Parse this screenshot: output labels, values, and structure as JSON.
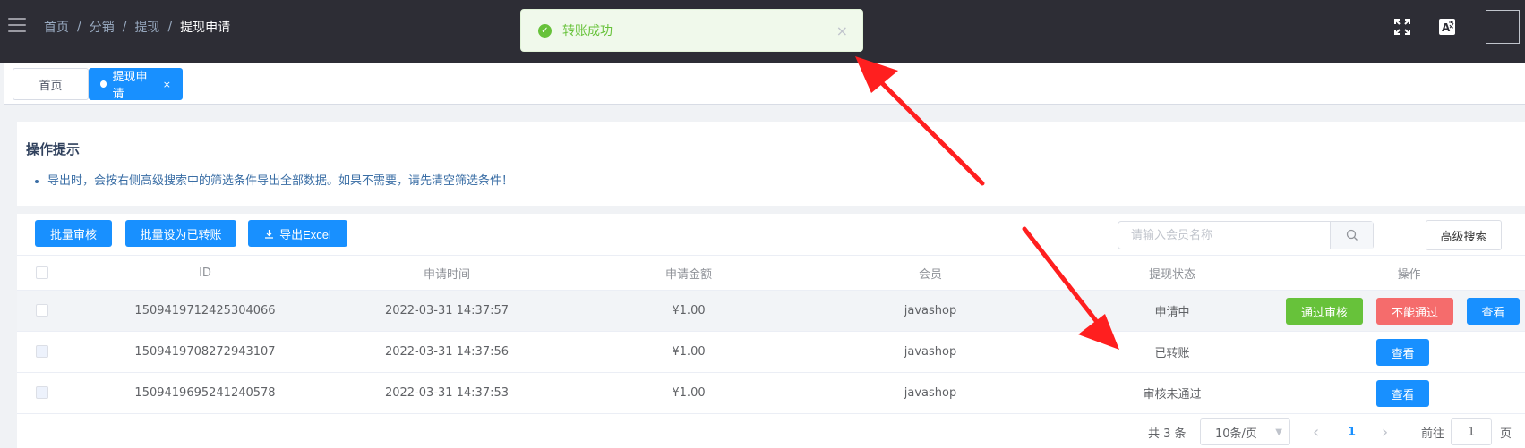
{
  "header": {
    "breadcrumb": [
      "首页",
      "分销",
      "提现",
      "提现申请"
    ],
    "separator": "/"
  },
  "toast": {
    "message": "转账成功",
    "close": "×"
  },
  "tags": [
    {
      "label": "首页"
    },
    {
      "label": "提现申请",
      "close": "×"
    }
  ],
  "tips": {
    "title": "操作提示",
    "items": [
      "导出时，会按右侧高级搜索中的筛选条件导出全部数据。如果不需要，请先清空筛选条件！"
    ]
  },
  "toolbar": {
    "batch_audit": "批量审核",
    "batch_transferred": "批量设为已转账",
    "export_excel": "导出Excel",
    "export_icon": "download-icon"
  },
  "search": {
    "placeholder": "请输入会员名称",
    "advanced": "高级搜索"
  },
  "table": {
    "columns": [
      "ID",
      "申请时间",
      "申请金额",
      "会员",
      "提现状态",
      "操作"
    ],
    "rows": [
      {
        "id": "1509419712425304066",
        "time": "2022-03-31 14:37:57",
        "amount": "¥1.00",
        "member": "javashop",
        "status": "申请中",
        "actions": [
          "通过审核",
          "不能通过",
          "查看"
        ]
      },
      {
        "id": "1509419708272943107",
        "time": "2022-03-31 14:37:56",
        "amount": "¥1.00",
        "member": "javashop",
        "status": "已转账",
        "actions": [
          "查看"
        ]
      },
      {
        "id": "1509419695241240578",
        "time": "2022-03-31 14:37:53",
        "amount": "¥1.00",
        "member": "javashop",
        "status": "审核未通过",
        "actions": [
          "查看"
        ]
      }
    ]
  },
  "pagination": {
    "total": "共 3 条",
    "page_size": "10条/页",
    "prev": "‹",
    "current": "1",
    "next": "›",
    "goto_prefix": "前往",
    "goto_value": "1",
    "goto_suffix": "页"
  },
  "colors": {
    "header_bg": "#2d2d35",
    "primary": "#1890ff",
    "success": "#67c23a",
    "danger": "#f56c6c",
    "annotation_arrow": "#ff1f1f"
  }
}
